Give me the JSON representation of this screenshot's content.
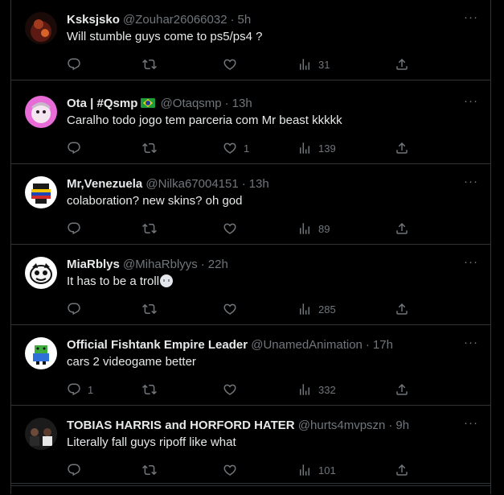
{
  "tweets": [
    {
      "name": "Ksksjsko",
      "handle": "@Zouhar26066032",
      "time": "5h",
      "text": "Will stumble guys come to ps5/ps4 ?",
      "replies": "",
      "retweets": "",
      "likes": "",
      "views": "31"
    },
    {
      "name": "Ota | #Qsmp",
      "flag": "brazil-flag-emoji",
      "handle": "@Otaqsmp",
      "time": "13h",
      "text": "Caralho todo jogo tem parceria com Mr beast kkkkk",
      "replies": "",
      "retweets": "",
      "likes": "1",
      "views": "139"
    },
    {
      "name": "Mr,Venezuela",
      "handle": "@Nilka67004151",
      "time": "13h",
      "text": "colaboration? new skins? oh god",
      "replies": "",
      "retweets": "",
      "likes": "",
      "views": "89"
    },
    {
      "name": "MiaRblys",
      "handle": "@MihaRblyys",
      "time": "22h",
      "text": "It has to be a troll",
      "emoji": "skull-emoji",
      "replies": "",
      "retweets": "",
      "likes": "",
      "views": "285"
    },
    {
      "name": "Official Fishtank Empire Leader",
      "handle": "@UnamedAnimation",
      "time": "17h",
      "text": "cars 2 videogame better",
      "replies": "1",
      "retweets": "",
      "likes": "",
      "views": "332"
    },
    {
      "name": "TOBIAS HARRIS and HORFORD HATER",
      "handle": "@hurts4mvpszn",
      "time": "9h",
      "text": "Literally fall guys ripoff like what",
      "replies": "",
      "retweets": "",
      "likes": "",
      "views": "101"
    }
  ],
  "ui": {
    "separator": "·",
    "more": "···"
  },
  "colors": {
    "background": "#000000",
    "text": "#e7e9ea",
    "secondary": "#71767b",
    "border": "#2f3336"
  },
  "icons": [
    "reply-icon",
    "retweet-icon",
    "like-icon",
    "views-icon",
    "share-icon",
    "more-icon"
  ]
}
